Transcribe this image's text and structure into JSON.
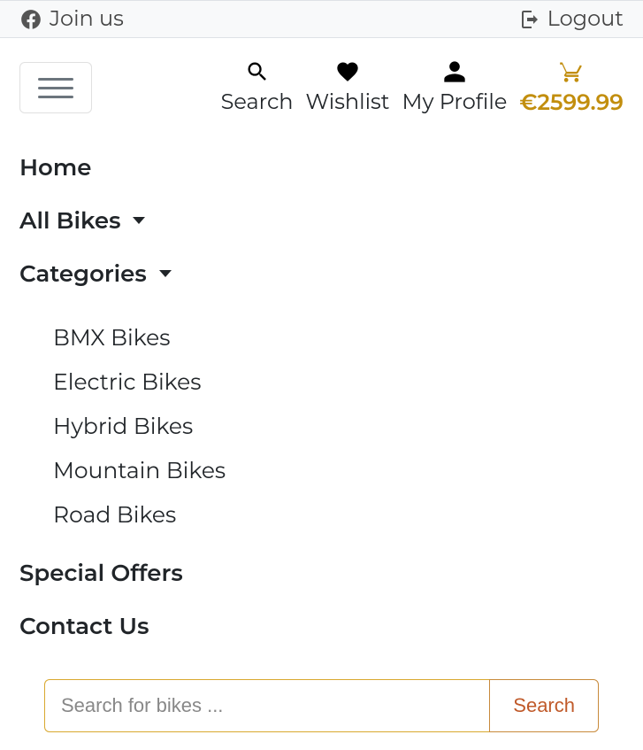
{
  "topbar": {
    "join_label": "Join us",
    "logout_label": "Logout"
  },
  "header": {
    "search_label": "Search",
    "wishlist_label": "Wishlist",
    "profile_label": "My Profile",
    "cart_total": "€2599.99"
  },
  "nav": {
    "home": "Home",
    "all_bikes": "All Bikes",
    "categories": "Categories",
    "special_offers": "Special Offers",
    "contact_us": "Contact Us",
    "category_items": {
      "0": "BMX Bikes",
      "1": "Electric Bikes",
      "2": "Hybrid Bikes",
      "3": "Mountain Bikes",
      "4": "Road Bikes"
    }
  },
  "search": {
    "placeholder": "Search for bikes ...",
    "button_label": "Search"
  }
}
